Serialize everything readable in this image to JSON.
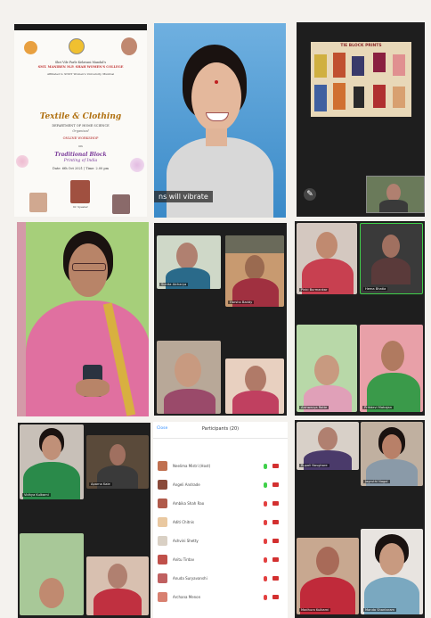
{
  "poster": {
    "line1": "Shri Vile Parle Kelavani Mandal's",
    "line2": "SMT. MANIBEN M.P. SHAH WOMEN'S COLLEGE",
    "line3": "Affiliated to SNDT Women's University, Mumbai",
    "title": "Textile & Clothing",
    "dept": "DEPARTMENT OF HOME SCIENCE",
    "organises": "Organised",
    "event_type": "ONLINE WORKSHOP",
    "on": "on",
    "subject_1": "Traditional Block",
    "subject_2": "Printing of India",
    "date": "Date: 6th Oct 2021 | Time: 2.00 pm",
    "speaker_caption": "Dr. Speaker"
  },
  "video": {
    "caption": "ns will vibrate"
  },
  "screen_share": {
    "heading": "TIE BLOCK PRINTS"
  },
  "participants": {
    "back_label": "Close",
    "title": "Participants (20)",
    "rows": [
      {
        "name": "Neelima Mistri (Host)",
        "color": "#c07050"
      },
      {
        "name": "Angeli Andrade",
        "color": "#8a4a3a"
      },
      {
        "name": "Ambika Shah Rao",
        "color": "#b05a4a"
      },
      {
        "name": "Aditi Chitnis",
        "color": "#e9c8a0"
      },
      {
        "name": "Ashvini Shetty",
        "color": "#d9d0c4"
      },
      {
        "name": "Anitu Tirdav",
        "color": "#c0504a"
      },
      {
        "name": "Anuda Suryavanshi",
        "color": "#c06060"
      },
      {
        "name": "Archana Menon",
        "color": "#d88070"
      }
    ]
  },
  "grid2": {
    "t1": "Sunita Aicharya",
    "t2": "Harsha Baddy",
    "t3": "",
    "t4": ""
  },
  "grid3": {
    "t1": "Pinki Burmankar",
    "t2": "Hema Bhatia",
    "t3": "Aishwarya Rotte",
    "t4": "Pritidevi Mahajan"
  },
  "grid4": {
    "t1": "Vidhya Kulkarni",
    "t2": "Aparna Kale",
    "t3": "",
    "t4": ""
  },
  "grid5": {
    "t1": "Rupali Navghare",
    "t2": "Jagruthi Nagal",
    "t3": "Madhura Kulkarni",
    "t4": "Manda Shantaram"
  },
  "colors": {
    "dark_bg": "#1e1e1e",
    "saree_pink": "#e070a0",
    "green_wall": "#a6cf7a",
    "active_border": "#3fd04a",
    "mic_red": "#e34040",
    "cam_red": "#d33030"
  }
}
